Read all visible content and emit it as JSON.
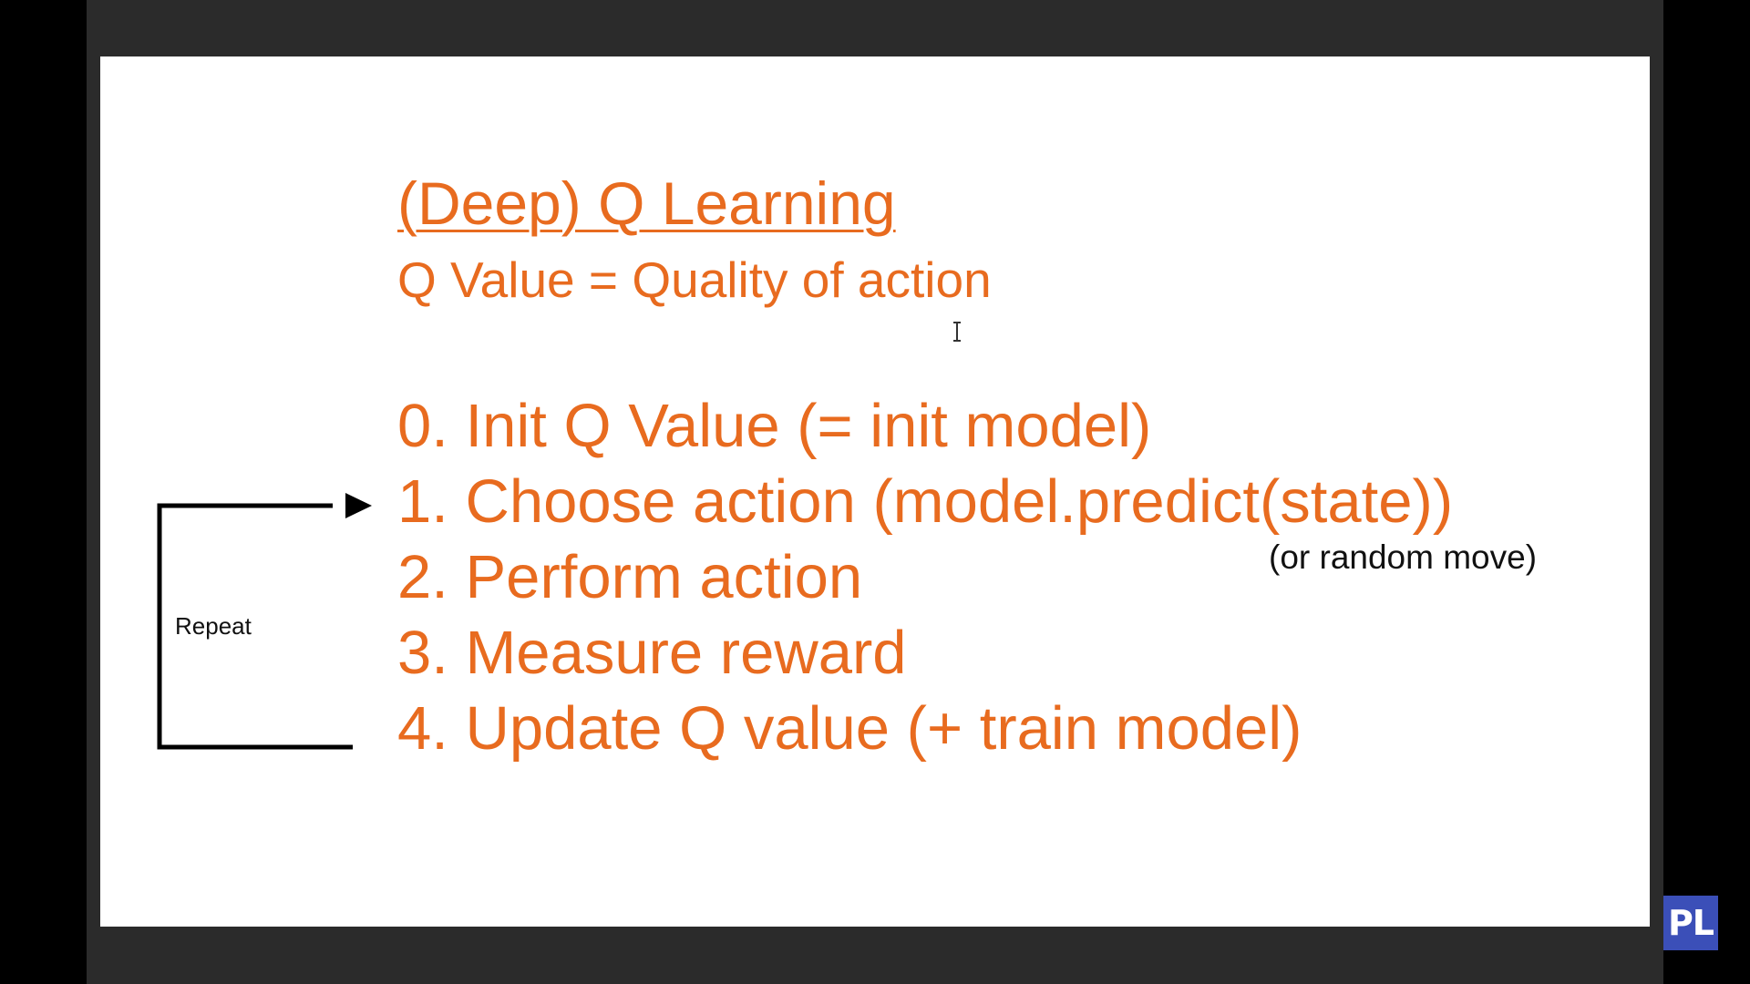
{
  "slide": {
    "title": "(Deep) Q Learning",
    "subtitle": "Q Value = Quality of action",
    "steps": [
      "0. Init Q Value (= init model)",
      "1. Choose action (model.predict(state))",
      "2. Perform action",
      "3. Measure reward",
      "4. Update Q value (+ train model)"
    ],
    "note": "(or random move)",
    "loop_label": "Repeat",
    "accent_color": "#e86b1f"
  },
  "overlay": {
    "logo_text": "PL",
    "logo_color": "#3b4fb8",
    "cursor_icon": "text-cursor-icon"
  }
}
